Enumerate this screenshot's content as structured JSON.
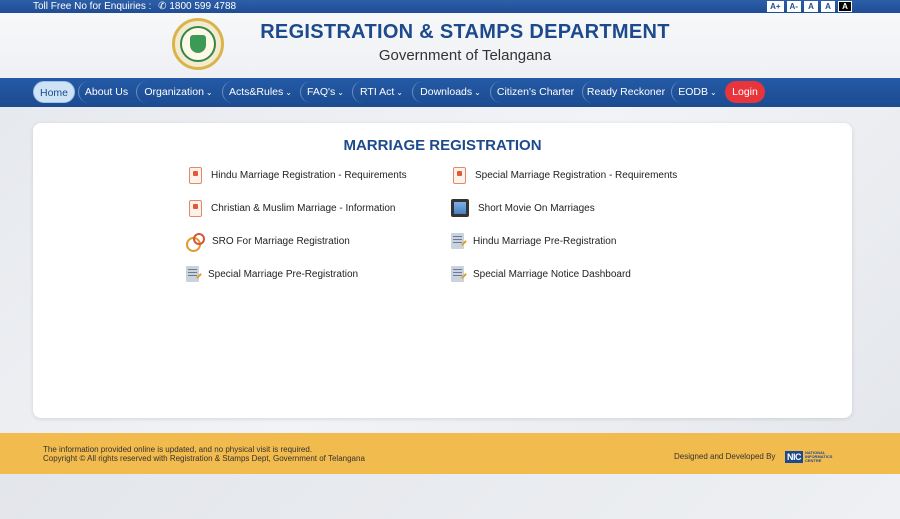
{
  "topbar": {
    "tollfree": "Toll Free No for Enquiries :",
    "phone": "1800 599 4788",
    "phone_icon": "phone-icon",
    "font_controls": [
      "A+",
      "A-",
      "A",
      "A",
      "A"
    ]
  },
  "header": {
    "title": "REGISTRATION & STAMPS DEPARTMENT",
    "subtitle": "Government of Telangana",
    "logo_icon": "telangana-emblem-icon"
  },
  "nav": {
    "items": [
      "Home",
      "About Us",
      "Organization",
      "Acts&Rules",
      "FAQ's",
      "RTI Act",
      "Downloads",
      "Citizen's Charter",
      "Ready Reckoner",
      "EODB",
      "Login"
    ],
    "active": "Home",
    "colors": {
      "bar": "#1f4d95",
      "active_bg": "#cfe3f6",
      "login_bg": "#e8353b"
    }
  },
  "main": {
    "title": "MARRIAGE REGISTRATION",
    "links": [
      {
        "label": "Hindu Marriage Registration - Requirements",
        "icon": "document-icon"
      },
      {
        "label": "Special Marriage Registration - Requirements",
        "icon": "document-icon"
      },
      {
        "label": "Christian & Muslim Marriage - Information",
        "icon": "document-icon"
      },
      {
        "label": "Short Movie On Marriages",
        "icon": "film-icon"
      },
      {
        "label": "SRO For Marriage Registration",
        "icon": "rings-icon"
      },
      {
        "label": "Hindu Marriage Pre-Registration",
        "icon": "form-icon"
      },
      {
        "label": "Special Marriage Pre-Registration",
        "icon": "form-icon"
      },
      {
        "label": "Special Marriage Notice Dashboard",
        "icon": "form-icon"
      }
    ]
  },
  "footer": {
    "line1": "The information provided online is updated, and no physical visit is required.",
    "line2": "Copyright © All rights reserved with Registration & Stamps Dept, Government of Telangana",
    "designed_by": "Designed and Developed By",
    "nic_mark": "NIC",
    "nic_text": "NATIONAL INFORMATICS CENTRE",
    "color": "#f2bb4e"
  }
}
